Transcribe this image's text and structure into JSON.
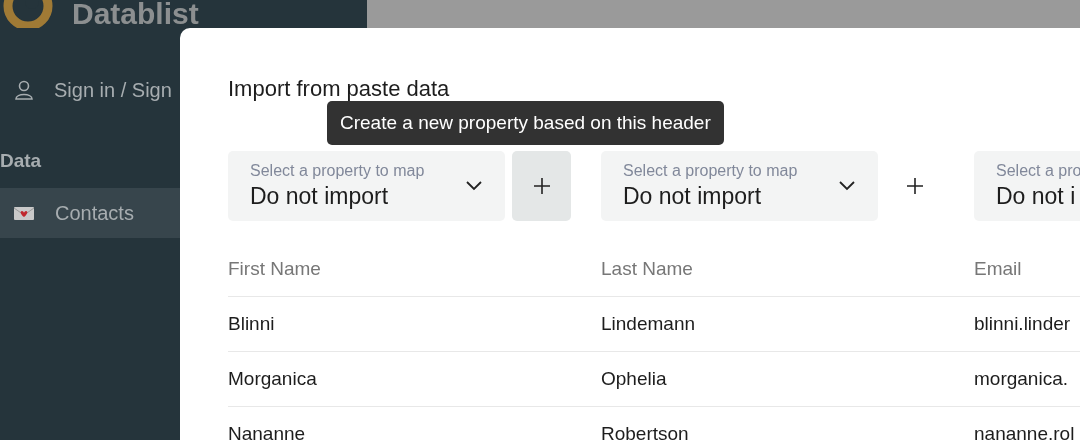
{
  "sidebar": {
    "logo": "Datablist",
    "account": "Sign in / Sign",
    "section": "Data",
    "items": [
      {
        "label": "Contacts",
        "selected": true
      }
    ]
  },
  "dialog": {
    "title": "Import from paste data",
    "tooltip": "Create a new property based on this header",
    "mappings": [
      {
        "kind": "full",
        "label": "Select a property to map",
        "value": "Do not import",
        "add_hovered": true
      },
      {
        "kind": "full",
        "label": "Select a property to map",
        "value": "Do not import",
        "add_hovered": false
      },
      {
        "kind": "partial",
        "label": "Select a pro",
        "value": "Do not i"
      }
    ],
    "columns": [
      "First Name",
      "Last Name",
      "Email"
    ],
    "rows": [
      [
        "Blinni",
        "Lindemann",
        "blinni.linder"
      ],
      [
        "Morganica",
        "Ophelia",
        "morganica."
      ],
      [
        "Nananne",
        "Robertson",
        "nananne.rol"
      ]
    ]
  }
}
